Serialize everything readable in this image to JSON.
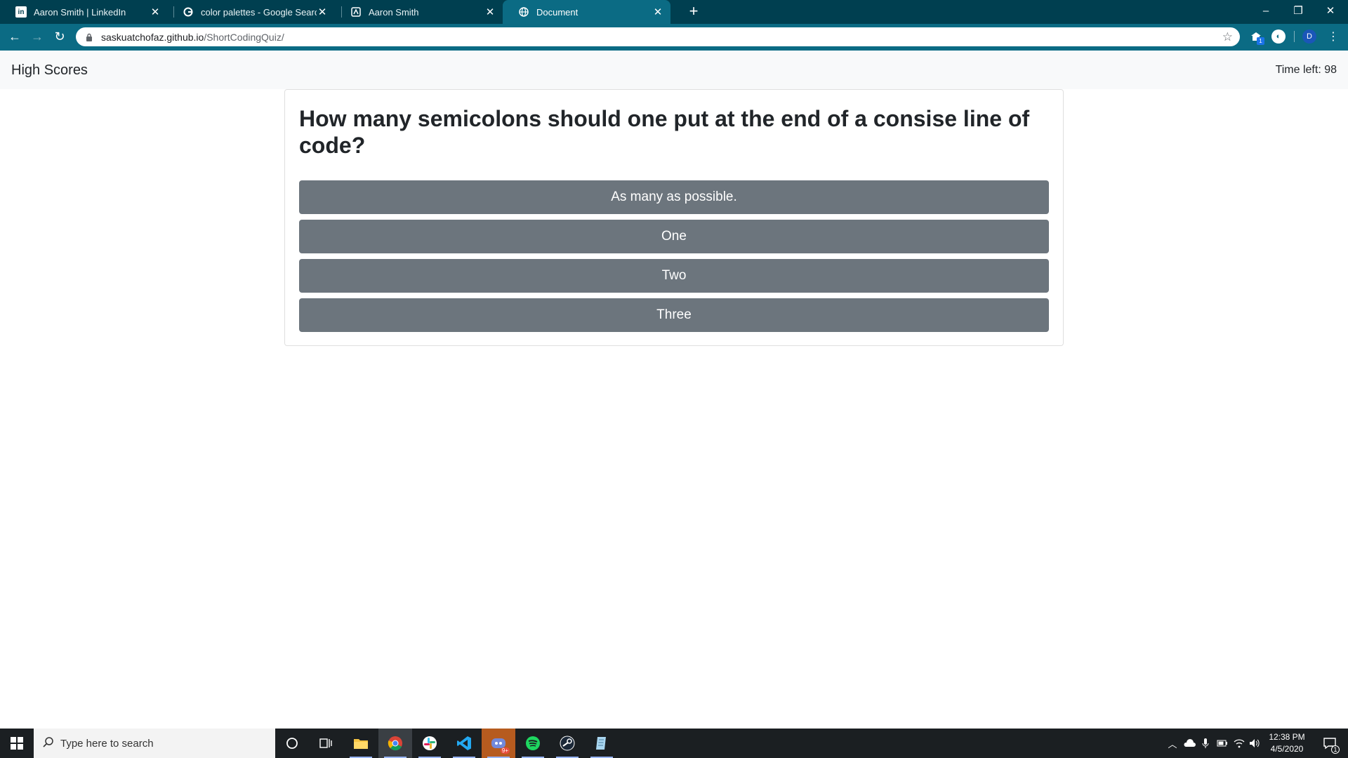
{
  "browser": {
    "tabs": [
      {
        "title": "Aaron Smith | LinkedIn",
        "icon": "linkedin-icon",
        "active": false
      },
      {
        "title": "color palettes - Google Search",
        "icon": "google-icon",
        "active": false
      },
      {
        "title": "Aaron Smith",
        "icon": "portfolio-icon",
        "active": false
      },
      {
        "title": "Document",
        "icon": "globe-icon",
        "active": true
      }
    ],
    "url_host": "saskuatchofaz.github.io",
    "url_path": "/ShortCodingQuiz/",
    "profile_initial": "D",
    "extension_badge": "1"
  },
  "page": {
    "high_scores_label": "High Scores",
    "timer_text": "Time left: 98",
    "question": "How many semicolons should one put at the end of a consise line of code?",
    "answers": [
      "As many as possible.",
      "One",
      "Two",
      "Three"
    ]
  },
  "taskbar": {
    "search_placeholder": "Type here to search",
    "time": "12:38 PM",
    "date": "4/5/2020",
    "notification_count": "1",
    "apps": [
      "cortana-icon",
      "task-view-icon",
      "file-explorer-icon",
      "chrome-icon",
      "slack-icon",
      "vscode-icon",
      "discord-icon",
      "spotify-icon",
      "steam-icon",
      "notepad-icon"
    ],
    "discord_badge": "9+"
  },
  "colors": {
    "tab_bar": "#003f50",
    "toolbar": "#0b6b84",
    "answer_button": "#6c757d",
    "page_bar": "#f8f9fa"
  }
}
